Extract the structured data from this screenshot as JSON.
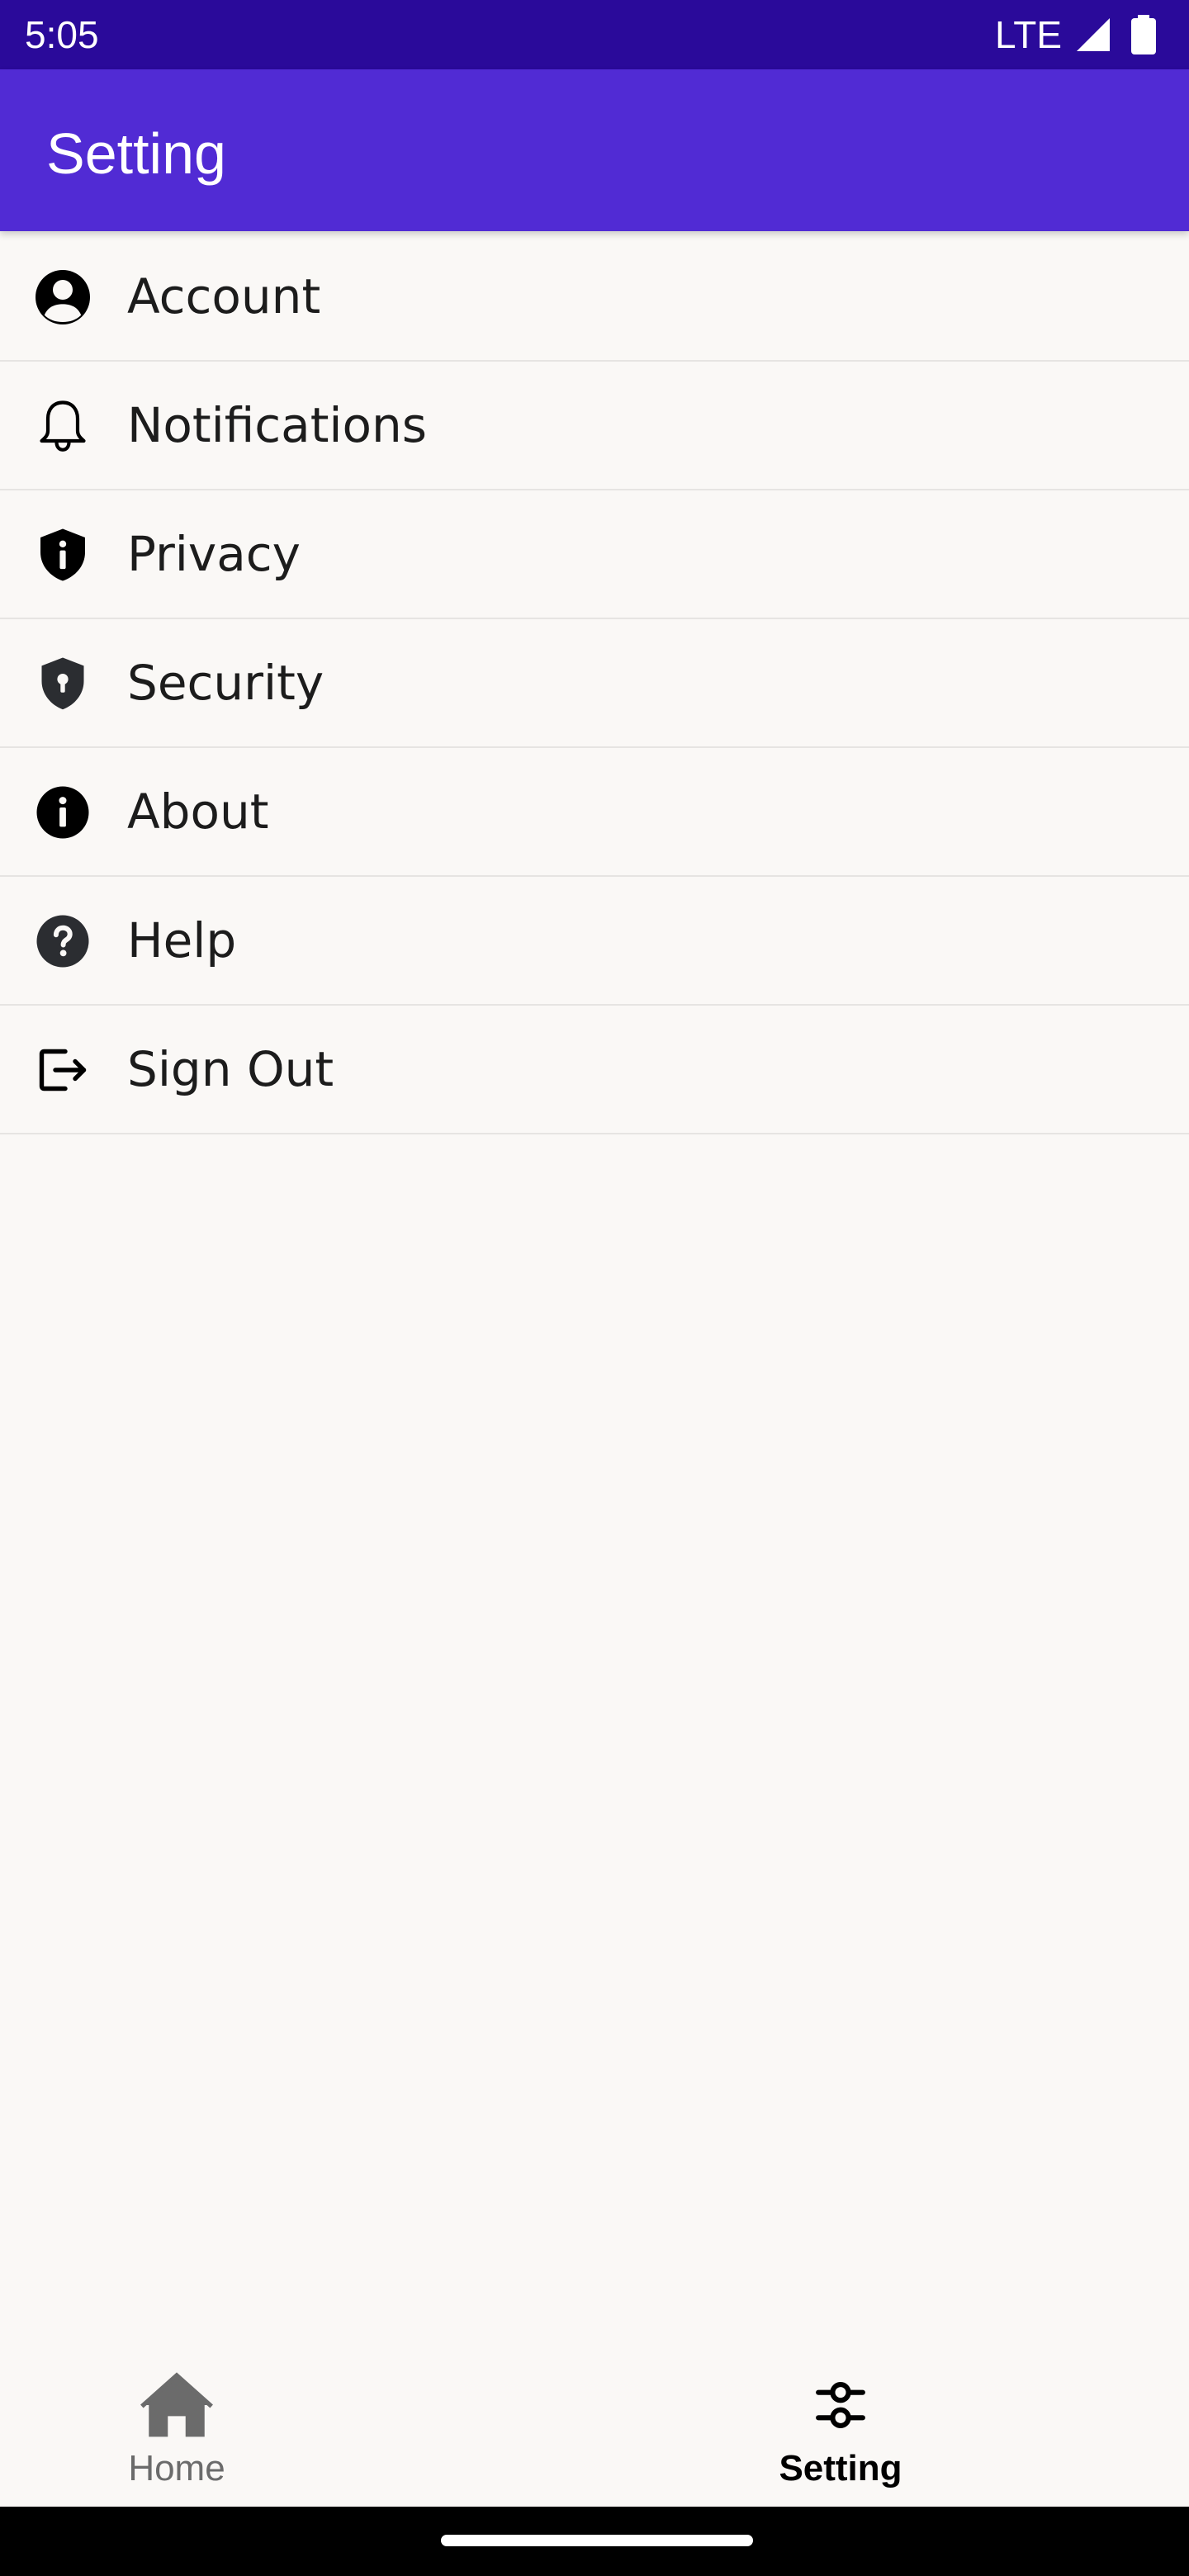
{
  "status_bar": {
    "time": "5:05",
    "network": "LTE",
    "signal_icon": "cell-signal-icon",
    "battery_icon": "battery-icon"
  },
  "app_bar": {
    "title": "Setting",
    "background_color": "#512bd4"
  },
  "settings": {
    "items": [
      {
        "label": "Account",
        "icon": "account-circle-icon"
      },
      {
        "label": "Notifications",
        "icon": "bell-icon"
      },
      {
        "label": "Privacy",
        "icon": "privacy-shield-icon"
      },
      {
        "label": "Security",
        "icon": "security-shield-lock-icon"
      },
      {
        "label": "About",
        "icon": "info-icon"
      },
      {
        "label": "Help",
        "icon": "help-icon"
      },
      {
        "label": "Sign Out",
        "icon": "sign-out-icon"
      }
    ]
  },
  "bottom_nav": {
    "tabs": [
      {
        "label": "Home",
        "icon": "home-icon",
        "selected": false
      },
      {
        "label": "Setting",
        "icon": "sliders-icon",
        "selected": true
      }
    ]
  }
}
